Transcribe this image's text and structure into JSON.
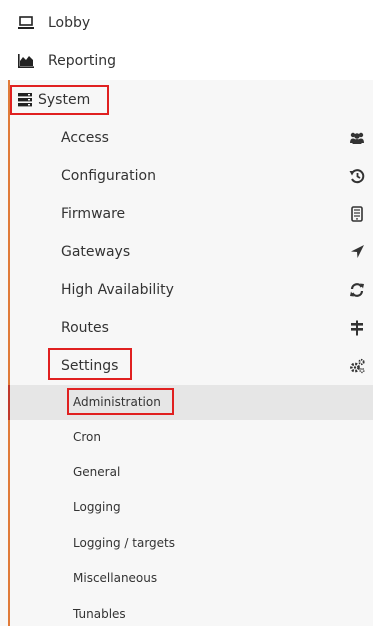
{
  "menu": {
    "lobby": {
      "label": "Lobby",
      "icon": "laptop-icon"
    },
    "reporting": {
      "label": "Reporting",
      "icon": "area-chart-icon"
    },
    "system": {
      "label": "System",
      "icon": "server-icon"
    }
  },
  "system_items": [
    {
      "label": "Access",
      "icon": "users-icon"
    },
    {
      "label": "Configuration",
      "icon": "history-icon"
    },
    {
      "label": "Firmware",
      "icon": "tablet-icon"
    },
    {
      "label": "Gateways",
      "icon": "location-arrow-icon"
    },
    {
      "label": "High Availability",
      "icon": "refresh-icon"
    },
    {
      "label": "Routes",
      "icon": "map-signs-icon"
    },
    {
      "label": "Settings",
      "icon": "cogs-icon"
    }
  ],
  "settings_items": [
    {
      "label": "Administration",
      "active": true
    },
    {
      "label": "Cron"
    },
    {
      "label": "General"
    },
    {
      "label": "Logging"
    },
    {
      "label": "Logging / targets"
    },
    {
      "label": "Miscellaneous"
    },
    {
      "label": "Tunables"
    }
  ],
  "colors": {
    "accent_bar": "#e07b39",
    "highlight_box": "#e02020",
    "active_background": "#e6e6e6"
  }
}
